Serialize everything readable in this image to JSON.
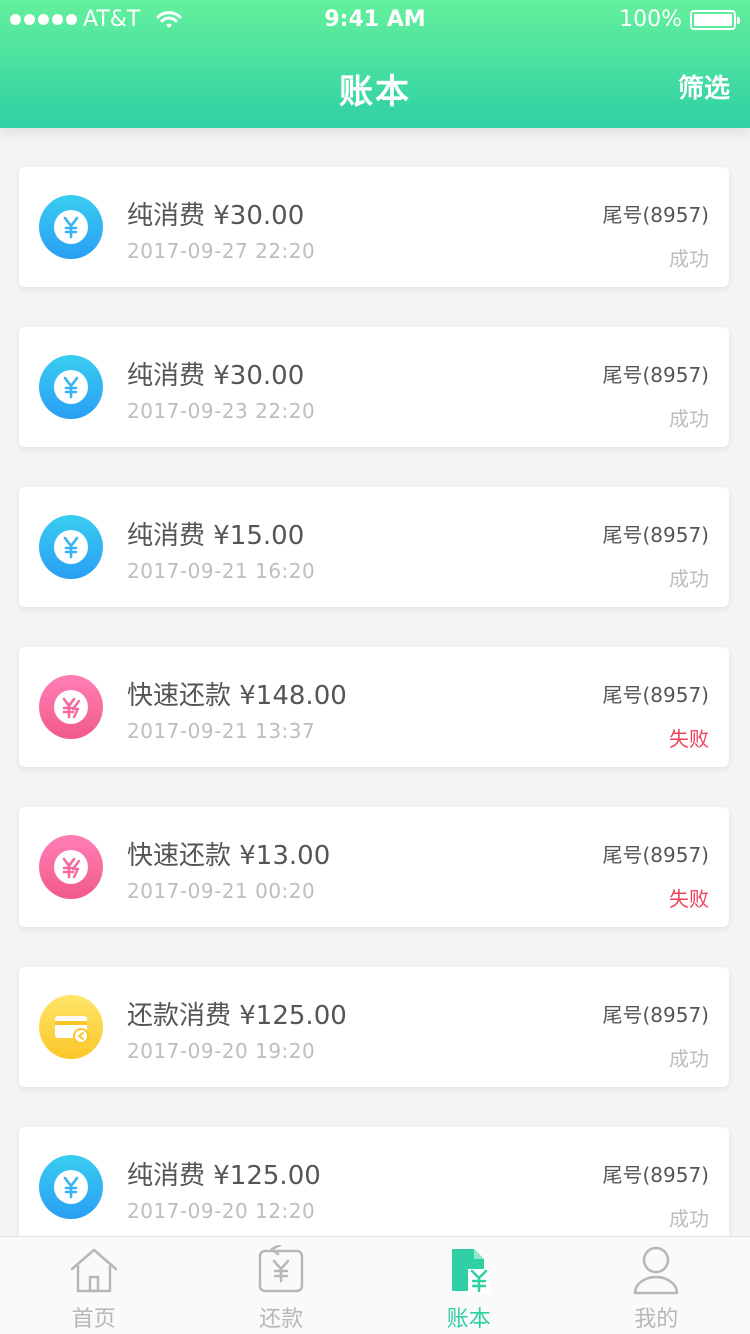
{
  "status_bar": {
    "carrier": "AT&T",
    "time": "9:41 AM",
    "battery": "100%"
  },
  "nav": {
    "title": "账本",
    "filter_label": "筛选"
  },
  "transactions": [
    {
      "title": "纯消费  ¥30.00",
      "date": "2017-09-27  22:20",
      "tail": "尾号(8957)",
      "status": "成功",
      "icon": "yuan-icon",
      "status_type": "success"
    },
    {
      "title": "纯消费  ¥30.00",
      "date": "2017-09-23  22:20",
      "tail": "尾号(8957)",
      "status": "成功",
      "icon": "yuan-icon",
      "status_type": "success"
    },
    {
      "title": "纯消费  ¥15.00",
      "date": "2017-09-21   16:20",
      "tail": "尾号(8957)",
      "status": "成功",
      "icon": "yuan-icon",
      "status_type": "success"
    },
    {
      "title": "快速还款  ¥148.00",
      "date": "2017-09-21   13:37",
      "tail": "尾号(8957)",
      "status": "失败",
      "icon": "fast-repay-icon",
      "status_type": "fail"
    },
    {
      "title": "快速还款  ¥13.00",
      "date": "2017-09-21   00:20",
      "tail": "尾号(8957)",
      "status": "失败",
      "icon": "fast-repay-icon",
      "status_type": "fail"
    },
    {
      "title": "还款消费  ¥125.00",
      "date": "2017-09-20  19:20",
      "tail": "尾号(8957)",
      "status": "成功",
      "icon": "card-repay-icon",
      "status_type": "success"
    },
    {
      "title": "纯消费  ¥125.00",
      "date": "2017-09-20  12:20",
      "tail": "尾号(8957)",
      "status": "成功",
      "icon": "yuan-icon",
      "status_type": "success"
    }
  ],
  "tabbar": {
    "home": "首页",
    "repay": "还款",
    "ledger": "账本",
    "mine": "我的",
    "active": "ledger"
  },
  "colors": {
    "header_gradient_top": "#64f09c",
    "header_gradient_bottom": "#2fd0a4",
    "fail": "#f0425a",
    "active_tab": "#2fd0a4"
  }
}
